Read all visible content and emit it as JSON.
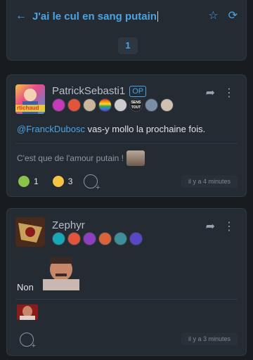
{
  "header": {
    "title": "J'ai le cul en sang putain",
    "back_icon": "arrow-left-icon",
    "favorite_icon": "star-icon",
    "refresh_icon": "refresh-icon",
    "current_page": "1"
  },
  "posts": [
    {
      "author": "PatrickSebasti1",
      "op_label": "OP",
      "mention": "@FranckDubosc",
      "text": " vas-y mollo la prochaine fois.",
      "signature": "C'est que de l'amour putain !",
      "avatar_overlay_text": "rtichaud",
      "badge_text": "SENS TOUT",
      "reactions": [
        {
          "emoji": "sick-face",
          "count": "1"
        },
        {
          "emoji": "grinning-face",
          "count": "3"
        }
      ],
      "timestamp": "il y a 4 minutes"
    },
    {
      "author": "Zephyr",
      "text": "Non",
      "timestamp": "il y a 3 minutes"
    }
  ],
  "colors": {
    "accent": "#4ba3e3",
    "card": "#252b33",
    "background": "#181c21"
  }
}
